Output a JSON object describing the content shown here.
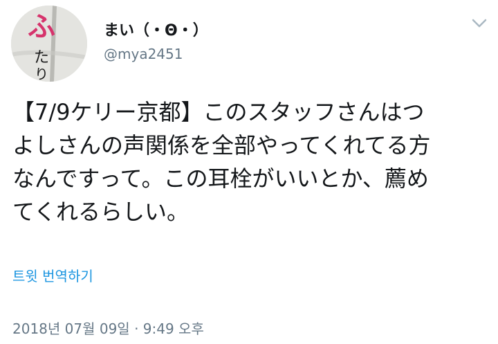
{
  "author": {
    "display_name": "まい（・Θ・）",
    "handle": "@mya2451",
    "avatar_chars": [
      "ふ",
      "た",
      "り"
    ]
  },
  "tweet": {
    "text": "【7/9ケリー京都】このスタッフさんはつ\nよしさんの声関係を全部やってくれてる方\nなんですって。この耳栓がいいとか、薦め\nてくれるらしい。"
  },
  "translate_label": "트윗 번역하기",
  "timestamp": "2018년 07월 09일 · 9:49 오후",
  "icons": {
    "menu": "chevron-down-icon"
  },
  "colors": {
    "link": "#1b95e0",
    "secondary_text": "#657786",
    "primary_text": "#14171a",
    "avatar_ink": "#d6336c"
  }
}
